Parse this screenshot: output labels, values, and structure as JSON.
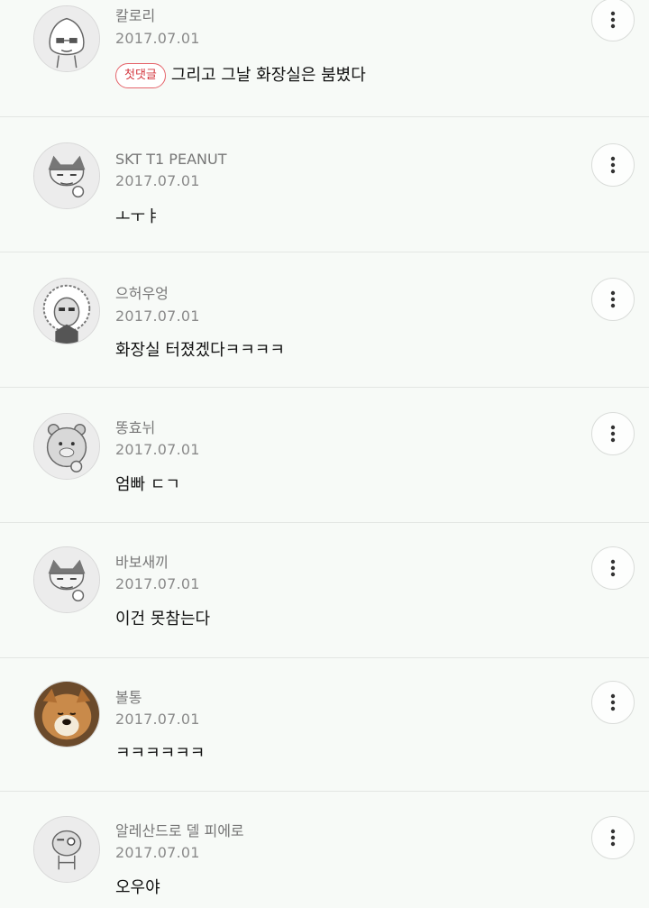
{
  "comments": [
    {
      "author": "칼로리",
      "date": "2017.07.01",
      "badge": "첫댓글",
      "text": "그리고 그날 화장실은 붐볐다",
      "avatar_icon": "character-avatar-icon"
    },
    {
      "author": "SKT T1 PEANUT",
      "date": "2017.07.01",
      "text": "ㅗㅜㅑ",
      "avatar_icon": "character-avatar-icon"
    },
    {
      "author": "으허우엉",
      "date": "2017.07.01",
      "text": "화장실 터졌겠다ㅋㅋㅋㅋ",
      "avatar_icon": "character-avatar-icon"
    },
    {
      "author": "똥효뉘",
      "date": "2017.07.01",
      "text": "엄빠 ㄷㄱ",
      "avatar_icon": "character-avatar-icon"
    },
    {
      "author": "바보새끼",
      "date": "2017.07.01",
      "text": "이건 못참는다",
      "avatar_icon": "character-avatar-icon"
    },
    {
      "author": "볼통",
      "date": "2017.07.01",
      "text": "ㅋㅋㅋㅋㅋㅋ",
      "avatar_icon": "dog-photo-avatar-icon"
    },
    {
      "author": "알레산드로 델 피에로",
      "date": "2017.07.01",
      "text": "오우야",
      "avatar_icon": "character-avatar-icon"
    }
  ],
  "more_icon": "more-vertical-icon"
}
